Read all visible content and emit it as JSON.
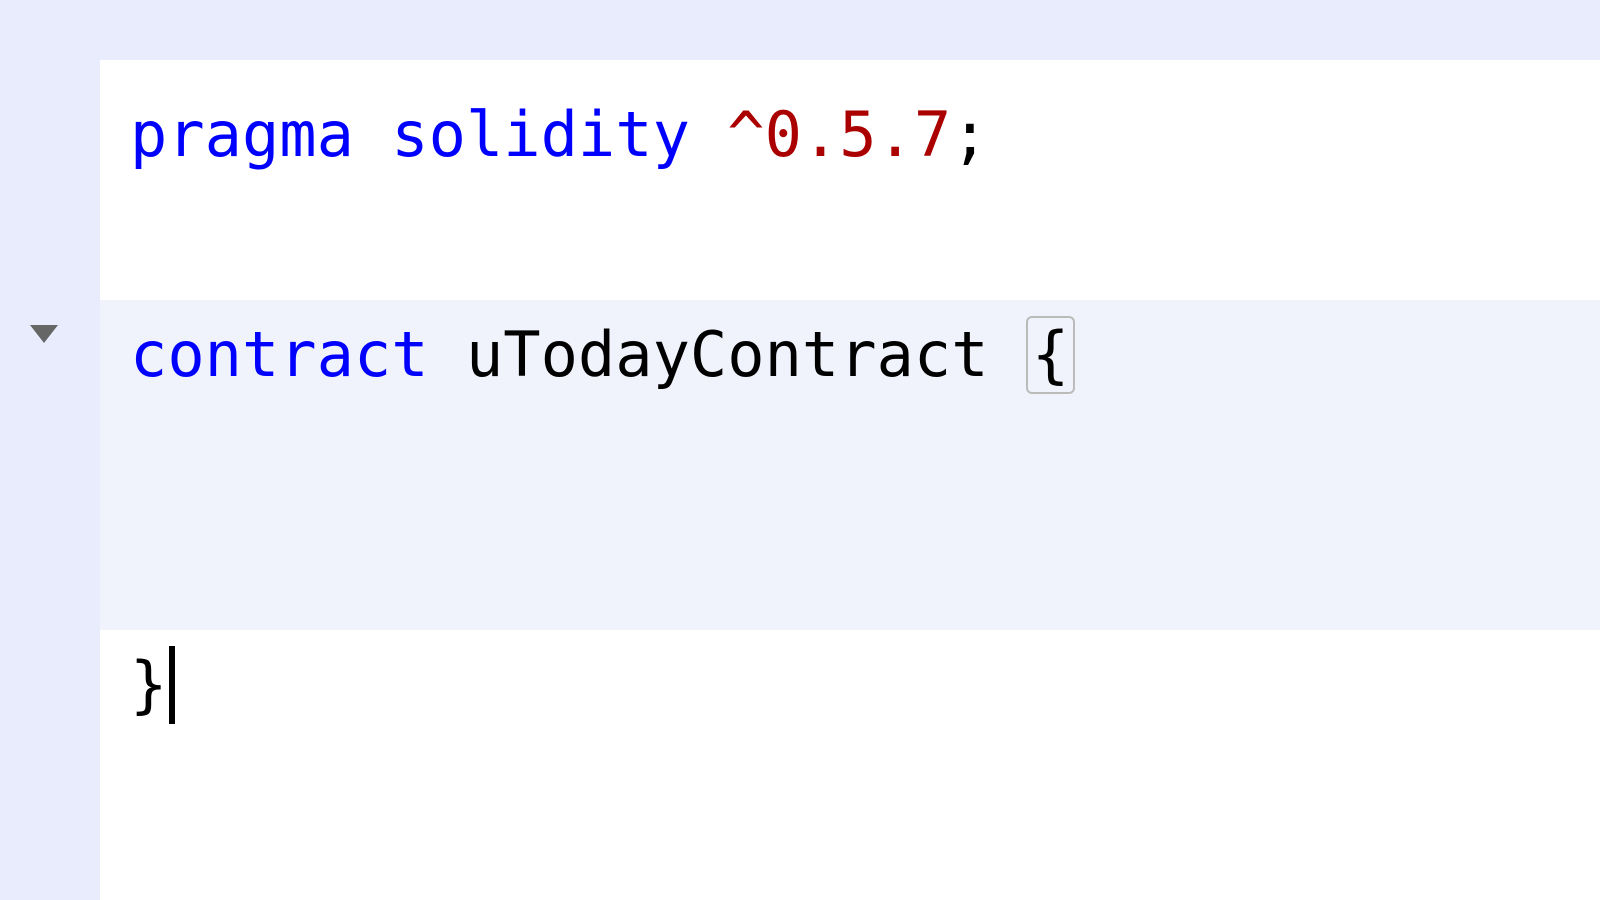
{
  "editor": {
    "language": "solidity",
    "lines": [
      {
        "tokens": [
          {
            "text": "pragma ",
            "class": "keyword"
          },
          {
            "text": "solidity ",
            "class": "keyword"
          },
          {
            "text": "^0.5.7",
            "class": "version"
          },
          {
            "text": ";",
            "class": "punct"
          }
        ]
      },
      {
        "tokens": []
      },
      {
        "highlight": true,
        "tokens": [
          {
            "text": "contract ",
            "class": "keyword"
          },
          {
            "text": "uTodayContract ",
            "class": "identifier"
          },
          {
            "text": "{",
            "class": "punct brace-match"
          }
        ]
      },
      {
        "highlight": true,
        "tokens": []
      },
      {
        "highlight": true,
        "tokens": []
      },
      {
        "cursor_after": true,
        "tokens": [
          {
            "text": "}",
            "class": "punct"
          }
        ]
      }
    ],
    "fold_marker_line": 3
  }
}
